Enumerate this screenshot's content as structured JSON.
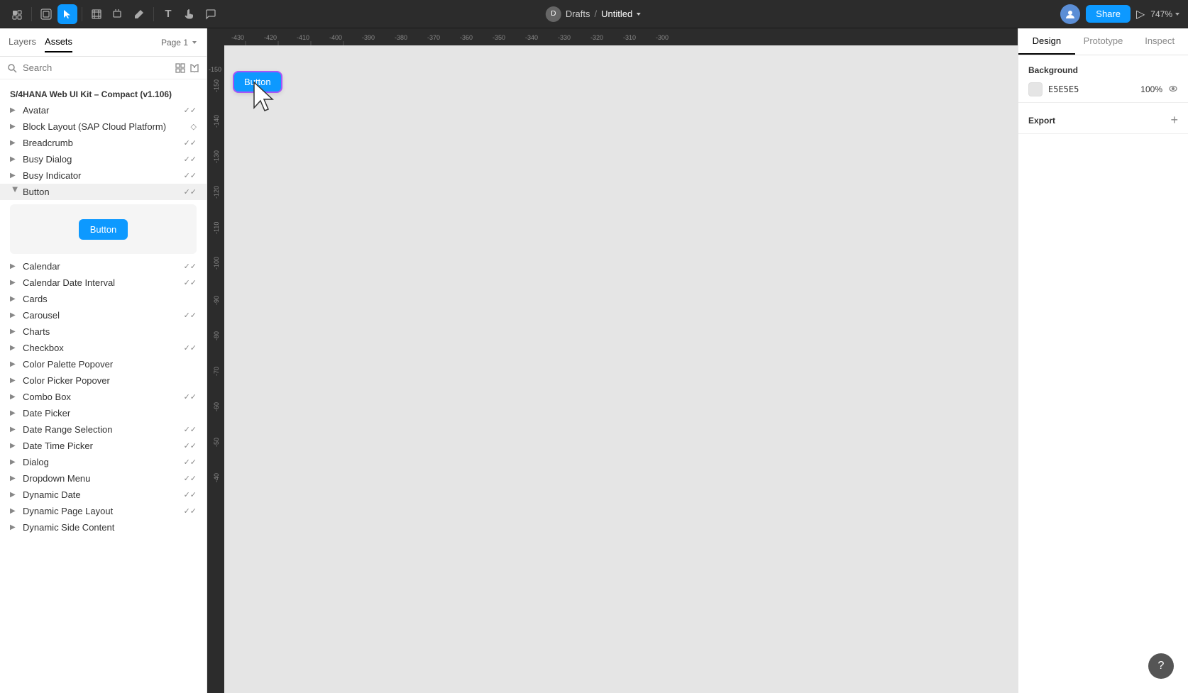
{
  "topbar": {
    "draft_label": "Drafts",
    "separator": "/",
    "page_title": "Untitled",
    "share_label": "Share",
    "zoom_level": "747%",
    "tools": [
      {
        "name": "select",
        "icon": "⬡",
        "active": false
      },
      {
        "name": "pointer",
        "icon": "↖",
        "active": true
      },
      {
        "name": "frame",
        "icon": "⬜",
        "active": false
      },
      {
        "name": "shape",
        "icon": "◇",
        "active": false
      },
      {
        "name": "pen",
        "icon": "✏",
        "active": false
      },
      {
        "name": "text",
        "icon": "T",
        "active": false
      },
      {
        "name": "hand",
        "icon": "✋",
        "active": false
      },
      {
        "name": "comment",
        "icon": "💬",
        "active": false
      }
    ]
  },
  "left_panel": {
    "tabs": [
      {
        "label": "Layers",
        "active": false
      },
      {
        "label": "Assets",
        "active": true
      }
    ],
    "page_selector": "Page 1",
    "search_placeholder": "Search",
    "kit_title": "S/4HANA Web UI Kit – Compact (v1.106)",
    "items": [
      {
        "label": "Avatar",
        "checks": "✓✓",
        "expanded": false
      },
      {
        "label": "Block Layout (SAP Cloud Platform)",
        "checks": "◇",
        "expanded": false
      },
      {
        "label": "Breadcrumb",
        "checks": "✓✓",
        "expanded": false
      },
      {
        "label": "Busy Dialog",
        "checks": "✓✓",
        "expanded": false
      },
      {
        "label": "Busy Indicator",
        "checks": "✓✓",
        "expanded": false
      },
      {
        "label": "Button",
        "checks": "✓✓",
        "expanded": true
      },
      {
        "label": "Calendar",
        "checks": "✓✓",
        "expanded": false
      },
      {
        "label": "Calendar Date Interval",
        "checks": "✓✓",
        "expanded": false
      },
      {
        "label": "Cards",
        "checks": "",
        "expanded": false
      },
      {
        "label": "Carousel",
        "checks": "✓✓",
        "expanded": false
      },
      {
        "label": "Charts",
        "checks": "",
        "expanded": false
      },
      {
        "label": "Checkbox",
        "checks": "✓✓",
        "expanded": false
      },
      {
        "label": "Color Palette Popover",
        "checks": "",
        "expanded": false
      },
      {
        "label": "Color Picker Popover",
        "checks": "",
        "expanded": false
      },
      {
        "label": "Combo Box",
        "checks": "✓✓",
        "expanded": false
      },
      {
        "label": "Date Picker",
        "checks": "",
        "expanded": false
      },
      {
        "label": "Date Range Selection",
        "checks": "✓✓",
        "expanded": false
      },
      {
        "label": "Date Time Picker",
        "checks": "✓✓",
        "expanded": false
      },
      {
        "label": "Dialog",
        "checks": "✓✓",
        "expanded": false
      },
      {
        "label": "Dropdown Menu",
        "checks": "✓✓",
        "expanded": false
      },
      {
        "label": "Dynamic Date",
        "checks": "✓✓",
        "expanded": false
      },
      {
        "label": "Dynamic Page Layout",
        "checks": "✓✓",
        "expanded": false
      },
      {
        "label": "Dynamic Side Content",
        "checks": "",
        "expanded": false
      }
    ],
    "preview_button_label": "Button"
  },
  "canvas": {
    "button_label": "Button",
    "ruler_marks_h": [
      "-430",
      "-420",
      "-410",
      "-400",
      "-390",
      "-380",
      "-370",
      "-360",
      "-350",
      "-340",
      "-330",
      "-320",
      "-310",
      "-300"
    ],
    "ruler_marks_v": [
      "-150",
      "-140",
      "-130",
      "-120",
      "-110",
      "-100",
      "-90",
      "-80",
      "-70",
      "-60",
      "-50",
      "-40"
    ]
  },
  "right_panel": {
    "tabs": [
      {
        "label": "Design",
        "active": true
      },
      {
        "label": "Prototype",
        "active": false
      },
      {
        "label": "Inspect",
        "active": false
      }
    ],
    "background_section": {
      "title": "Background",
      "color_hex": "E5E5E5",
      "opacity": "100%",
      "color_value": "#E5E5E5"
    },
    "export_section": {
      "title": "Export"
    }
  },
  "help_button_label": "?"
}
